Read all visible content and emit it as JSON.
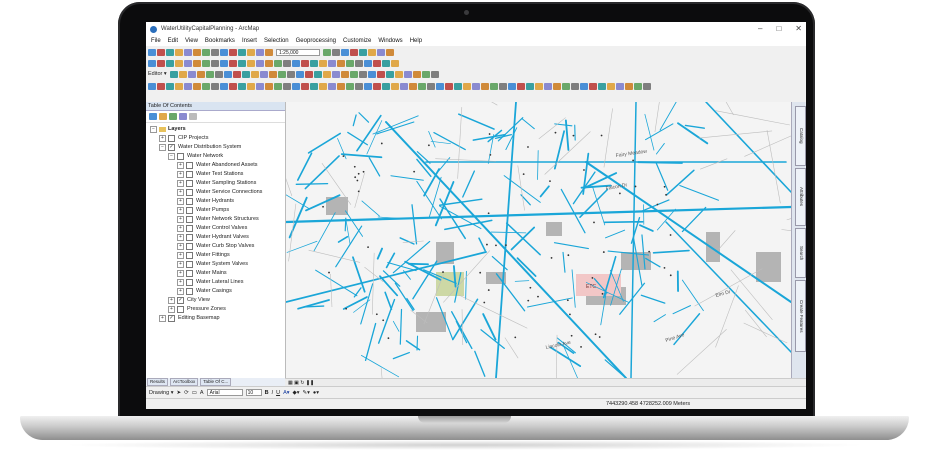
{
  "window": {
    "title": "WaterUtilityCapitalPlanning - ArcMap",
    "controls": [
      "–",
      "□",
      "✕"
    ]
  },
  "menu": [
    "File",
    "Edit",
    "View",
    "Bookmarks",
    "Insert",
    "Selection",
    "Geoprocessing",
    "Customize",
    "Windows",
    "Help"
  ],
  "toolbar": {
    "scale": "1:25,000",
    "editor_label": "Editor ▾"
  },
  "toc": {
    "title": "Table Of Contents",
    "layers": [
      {
        "label": "Layers",
        "level": 0,
        "expand": "−",
        "check": "",
        "folder": true
      },
      {
        "label": "CIP Projects",
        "level": 1,
        "expand": "+",
        "check": " "
      },
      {
        "label": "Water Distribution System",
        "level": 1,
        "expand": "−",
        "check": "✓"
      },
      {
        "label": "Water Network",
        "level": 2,
        "expand": "−",
        "check": " "
      },
      {
        "label": "Water Abandoned Assets",
        "level": 3,
        "expand": "+",
        "check": " "
      },
      {
        "label": "Water Test Stations",
        "level": 3,
        "expand": "+",
        "check": " "
      },
      {
        "label": "Water Sampling Stations",
        "level": 3,
        "expand": "+",
        "check": " "
      },
      {
        "label": "Water Service Connections",
        "level": 3,
        "expand": "+",
        "check": " "
      },
      {
        "label": "Water Hydrants",
        "level": 3,
        "expand": "+",
        "check": " "
      },
      {
        "label": "Water Pumps",
        "level": 3,
        "expand": "+",
        "check": " "
      },
      {
        "label": "Water Network Structures",
        "level": 3,
        "expand": "+",
        "check": " "
      },
      {
        "label": "Water Control Valves",
        "level": 3,
        "expand": "+",
        "check": " "
      },
      {
        "label": "Water Hydrant Valves",
        "level": 3,
        "expand": "+",
        "check": " "
      },
      {
        "label": "Water Curb Stop Valves",
        "level": 3,
        "expand": "+",
        "check": " "
      },
      {
        "label": "Water Fittings",
        "level": 3,
        "expand": "+",
        "check": " "
      },
      {
        "label": "Water System Valves",
        "level": 3,
        "expand": "+",
        "check": " "
      },
      {
        "label": "Water Mains",
        "level": 3,
        "expand": "+",
        "check": " "
      },
      {
        "label": "Water Lateral Lines",
        "level": 3,
        "expand": "+",
        "check": " "
      },
      {
        "label": "Water Casings",
        "level": 3,
        "expand": "+",
        "check": " "
      },
      {
        "label": "City View",
        "level": 2,
        "expand": "+",
        "check": "✓"
      },
      {
        "label": "Pressure Zones",
        "level": 2,
        "expand": "+",
        "check": " "
      },
      {
        "label": "Editing Basemap",
        "level": 1,
        "expand": "+",
        "check": "✓"
      }
    ]
  },
  "bottom_tabs": [
    "Results",
    "ArcToolbox",
    "Table Of C..."
  ],
  "drawing": {
    "label": "Drawing ▾",
    "font": "Arial",
    "size": "10"
  },
  "status": {
    "coordinates": "7443290.458  4728252.009 Meters"
  },
  "right_dock": [
    "Catalog",
    "Attributes",
    "Search",
    "Create Features"
  ],
  "map": {
    "labels": [
      "Fairy Meadow",
      "Falcon Dr",
      "ETC",
      "Lincoln Ave",
      "Pine Ave",
      "Elm Dr"
    ],
    "colors": {
      "water_lines": "#1aa6d8",
      "parcels": "#a8a8a8",
      "highlight": "#f2c7c7",
      "park": "#cdd8a5",
      "background": "#f4f4f4"
    }
  }
}
